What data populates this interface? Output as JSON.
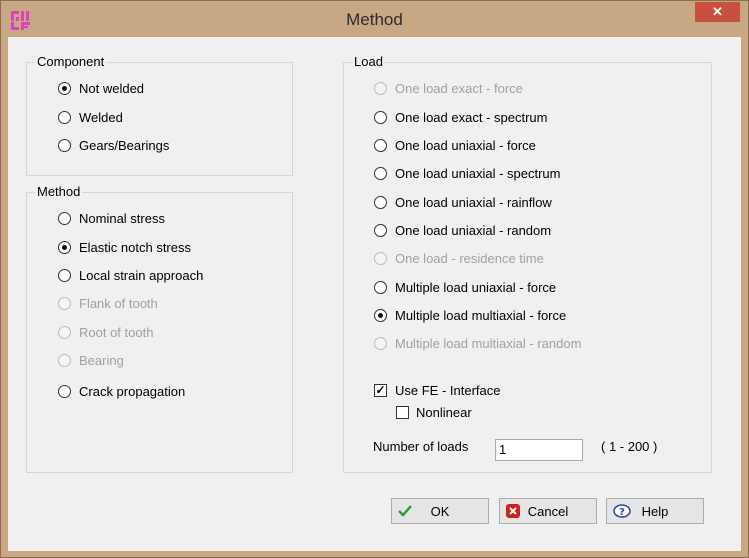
{
  "window": {
    "title": "Method",
    "close_label": "✕"
  },
  "component": {
    "title": "Component",
    "options": [
      {
        "label": "Not welded",
        "checked": true,
        "disabled": false
      },
      {
        "label": "Welded",
        "checked": false,
        "disabled": false
      },
      {
        "label": "Gears/Bearings",
        "checked": false,
        "disabled": false
      }
    ]
  },
  "method": {
    "title": "Method",
    "options": [
      {
        "label": "Nominal stress",
        "checked": false,
        "disabled": false
      },
      {
        "label": "Elastic notch stress",
        "checked": true,
        "disabled": false
      },
      {
        "label": "Local strain approach",
        "checked": false,
        "disabled": false
      },
      {
        "label": "Flank of tooth",
        "checked": false,
        "disabled": true
      },
      {
        "label": "Root of tooth",
        "checked": false,
        "disabled": true
      },
      {
        "label": "Bearing",
        "checked": false,
        "disabled": true
      },
      {
        "label": "Crack propagation",
        "checked": false,
        "disabled": false
      }
    ]
  },
  "load": {
    "title": "Load",
    "options": [
      {
        "label": "One load exact - force",
        "checked": false,
        "disabled": true
      },
      {
        "label": "One load exact - spectrum",
        "checked": false,
        "disabled": false
      },
      {
        "label": "One load uniaxial - force",
        "checked": false,
        "disabled": false
      },
      {
        "label": "One load uniaxial - spectrum",
        "checked": false,
        "disabled": false
      },
      {
        "label": "One load uniaxial - rainflow",
        "checked": false,
        "disabled": false
      },
      {
        "label": "One load uniaxial - random",
        "checked": false,
        "disabled": false
      },
      {
        "label": "One load - residence time",
        "checked": false,
        "disabled": true
      },
      {
        "label": "Multiple load uniaxial - force",
        "checked": false,
        "disabled": false
      },
      {
        "label": "Multiple load multiaxial - force",
        "checked": true,
        "disabled": false
      },
      {
        "label": "Multiple load multiaxial - random",
        "checked": false,
        "disabled": true
      }
    ],
    "use_fe": {
      "label": "Use FE - Interface",
      "checked": true
    },
    "nonlinear": {
      "label": "Nonlinear",
      "checked": false
    },
    "num_loads": {
      "label": "Number of loads",
      "value": "1",
      "range": "( 1 - 200 )"
    }
  },
  "buttons": {
    "ok": "OK",
    "cancel": "Cancel",
    "help": "Help"
  },
  "colors": {
    "frame": "#c8a884",
    "close": "#c7503f",
    "ok_icon": "#2e9b2e",
    "cancel_icon": "#d02020",
    "help_icon": "#2a3fb0",
    "app_icon": "#e040c0"
  }
}
